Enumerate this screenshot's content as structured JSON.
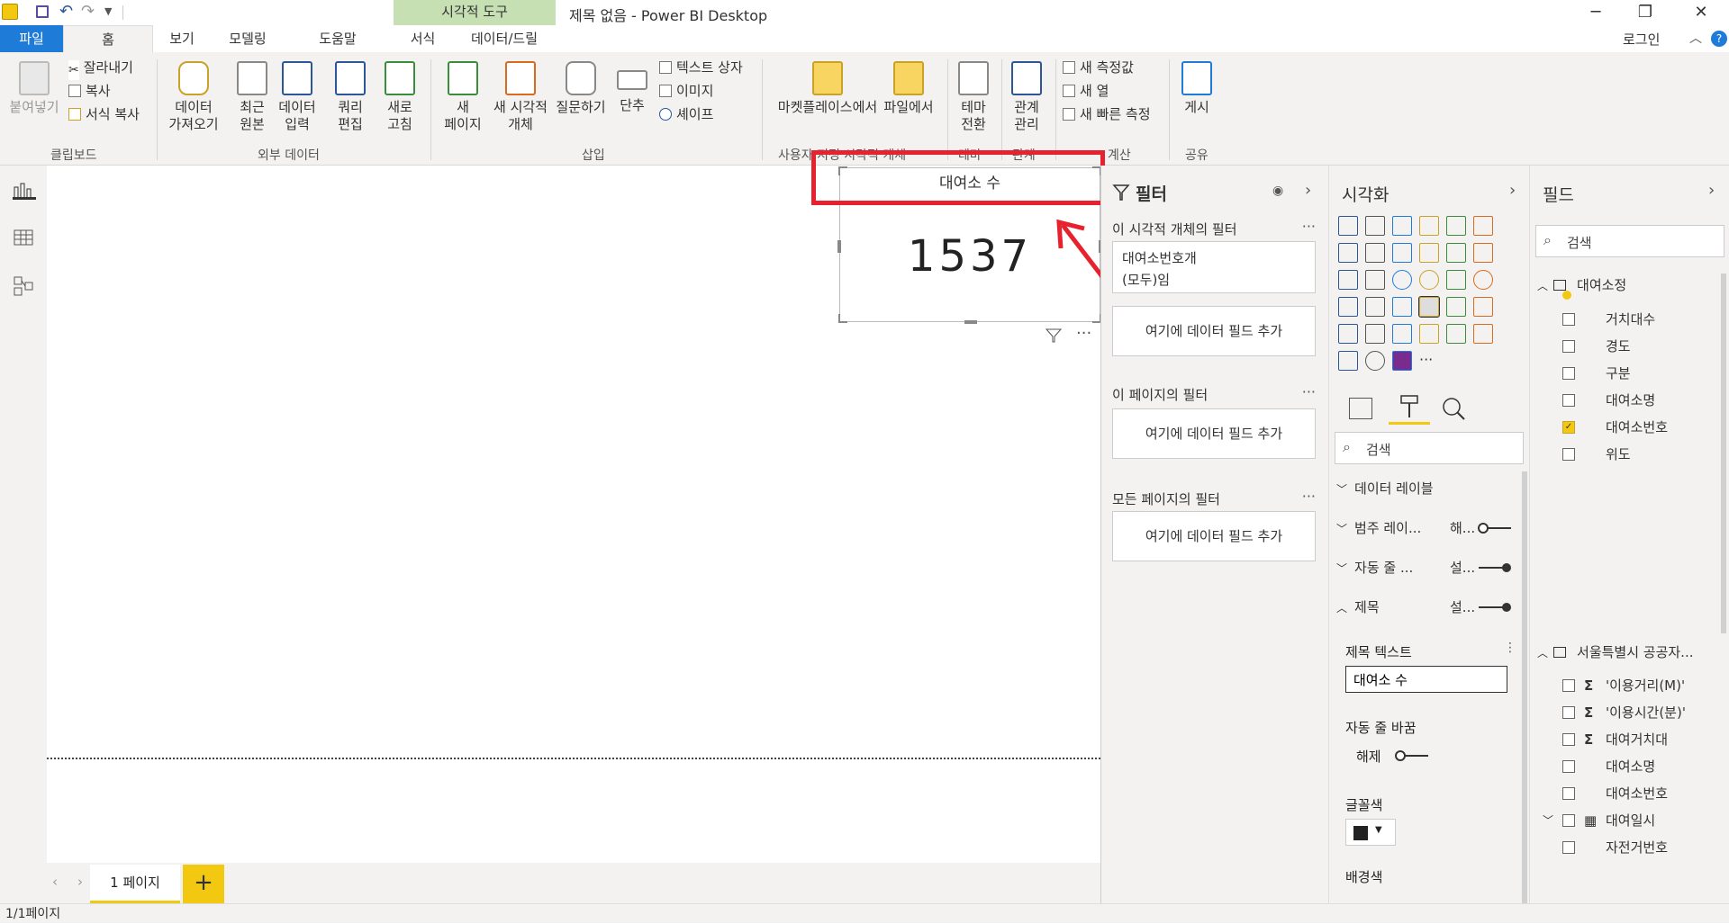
{
  "window": {
    "title": "제목 없음 - Power BI Desktop",
    "context_tab": "시각적 도구",
    "sign_in": "로그인"
  },
  "tabs": [
    "파일",
    "홈",
    "보기",
    "모델링",
    "도움말",
    "서식",
    "데이터/드릴"
  ],
  "ribbon": {
    "paste": "붙여넣기",
    "cut": "잘라내기",
    "copy": "복사",
    "format_copy": "서식 복사",
    "get_data": [
      "데이터",
      "가져오기"
    ],
    "recent": [
      "최근",
      "원본"
    ],
    "enter_data": [
      "데이터",
      "입력"
    ],
    "edit_query": [
      "쿼리",
      "편집"
    ],
    "refresh": [
      "새로",
      "고침"
    ],
    "new_page": [
      "새",
      "페이지"
    ],
    "new_visual": [
      "새 시각적",
      "개체"
    ],
    "qa": "질문하기",
    "buttons": "단추",
    "text_box": "텍스트 상자",
    "image": "이미지",
    "shape": "셰이프",
    "marketplace": "마켓플레이스에서",
    "from_file": "파일에서",
    "theme": [
      "테마",
      "전환"
    ],
    "relations": [
      "관계",
      "관리"
    ],
    "new_measure": "새 측정값",
    "new_column": "새 열",
    "quick_measure": "새 빠른 측정",
    "publish": "게시",
    "groups": {
      "clipboard": "클립보드",
      "external": "외부 데이터",
      "insert": "삽입",
      "custom": "사용자 지정 시각적 개체",
      "theme": "테마",
      "relation": "관계",
      "calc": "계산",
      "share": "공유"
    }
  },
  "card": {
    "title": "대여소 수",
    "value": "1537"
  },
  "filters": {
    "header": "필터",
    "visual_filters": "이 시각적 개체의 필터",
    "filter_field": "대여소번호개",
    "filter_value": "(모두)임",
    "add_field": "여기에 데이터 필드 추가",
    "page_filters": "이 페이지의 필터",
    "all_filters": "모든 페이지의 필터",
    "more": "···"
  },
  "viz": {
    "header": "시각화",
    "search_placeholder": "검색",
    "data_label": "데이터 레이블",
    "category_label": "범주 레이...",
    "category_state": "해...",
    "word_wrap": "자동 줄 ...",
    "word_wrap_state": "설...",
    "title_section": "제목",
    "title_state": "설...",
    "title_text_label": "제목 텍스트",
    "title_text_value": "대여소 수",
    "auto_wrap": "자동 줄 바꿈",
    "auto_wrap_state": "해제",
    "font_color": "글꼴색",
    "bg_color": "배경색",
    "more": "···"
  },
  "fields": {
    "header": "필드",
    "search_placeholder": "검색",
    "table1": "대여소정",
    "table1_fields": [
      {
        "name": "거치대수",
        "checked": false
      },
      {
        "name": "경도",
        "checked": false
      },
      {
        "name": "구분",
        "checked": false
      },
      {
        "name": "대여소명",
        "checked": false
      },
      {
        "name": "대여소번호",
        "checked": true
      },
      {
        "name": "위도",
        "checked": false
      }
    ],
    "table2": "서울특별시 공공자...",
    "table2_fields": [
      {
        "name": "'이용거리(M)'",
        "sigma": true
      },
      {
        "name": "'이용시간(분)'",
        "sigma": true
      },
      {
        "name": "대여거치대",
        "sigma": true
      },
      {
        "name": "대여소명",
        "sigma": false
      },
      {
        "name": "대여소번호",
        "sigma": false
      },
      {
        "name": "대여일시",
        "sigma": false
      },
      {
        "name": "자전거번호",
        "sigma": false
      }
    ]
  },
  "pages": {
    "tab": "1 페이지",
    "add": "+",
    "status": "1/1페이지"
  },
  "colors": {
    "accent": "#f2c811",
    "file_tab": "#1f7bd8",
    "highlight": "#e8212e",
    "context": "#c6e0b4"
  }
}
